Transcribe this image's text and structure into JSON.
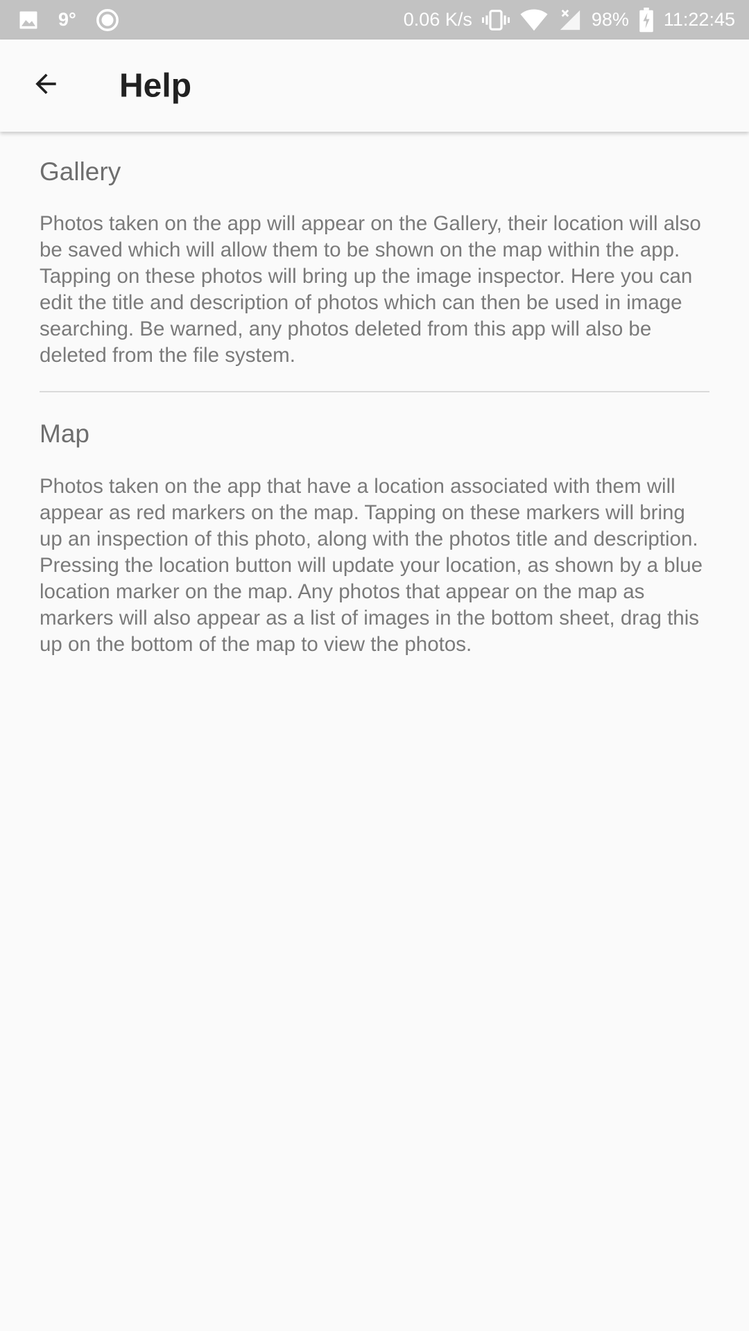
{
  "status_bar": {
    "temperature": "9°",
    "network_speed": "0.06 K/s",
    "battery": "98%",
    "time": "11:22:45",
    "icons": [
      "image-icon",
      "circle-icon",
      "vibrate-icon",
      "wifi-icon",
      "signal-icon",
      "battery-charging-icon"
    ]
  },
  "app_bar": {
    "title": "Help",
    "back_icon": "arrow-back-icon"
  },
  "sections": [
    {
      "title": "Gallery",
      "body": "Photos taken on the app will appear on the Gallery, their location will also be saved which will allow them to be shown on the map within the app. Tapping on these photos will bring up the image inspector. Here you can edit the title and description of photos which can then be used in image searching. Be warned, any photos deleted from this app will also be deleted from the file system."
    },
    {
      "title": "Map",
      "body": "Photos taken on the app that have a location associated with them will appear as red markers on the map. Tapping on these markers will bring up an inspection of this photo, along with the photos title and description. Pressing the location button will update your location, as shown by a blue location marker on the map. Any photos that appear on the map as markers will also appear as a list of images in the bottom sheet, drag this up on the bottom of the map to view the photos."
    }
  ],
  "colors": {
    "status_bar_bg": "#c2c2c2",
    "background": "#fafafa",
    "title_text": "#212121",
    "section_title": "#6e6e6e",
    "body_text": "#7a7a7a",
    "divider": "#dadada"
  }
}
